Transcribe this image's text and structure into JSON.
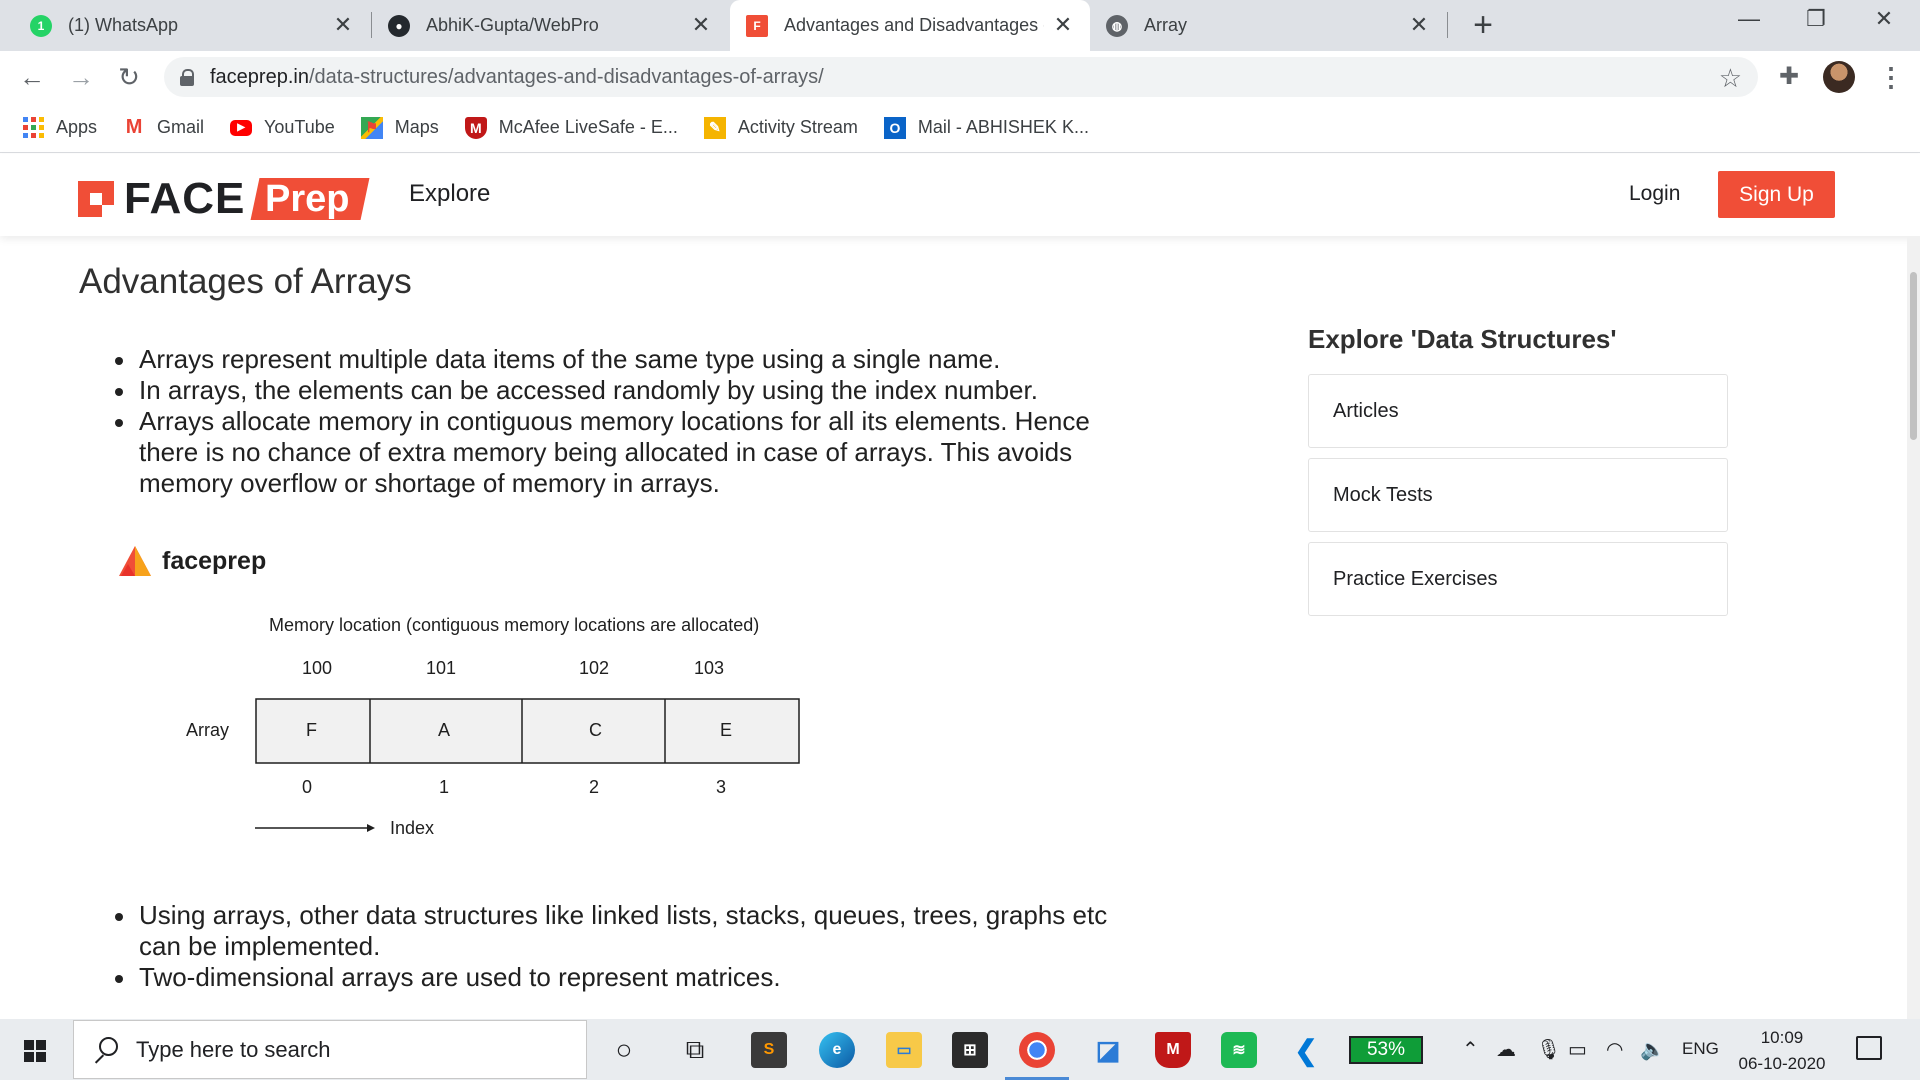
{
  "browser": {
    "tabs": [
      {
        "title": "(1) WhatsApp",
        "icon": "whatsapp-icon",
        "active": false
      },
      {
        "title": "AbhiK-Gupta/WebPro",
        "icon": "github-icon",
        "active": false
      },
      {
        "title": "Advantages and Disadvantages o",
        "icon": "faceprep-icon",
        "active": true
      },
      {
        "title": "Array",
        "icon": "globe-icon",
        "active": false
      }
    ],
    "new_tab_label": "+",
    "url": {
      "domain": "faceprep.in",
      "path": "/data-structures/advantages-and-disadvantages-of-arrays/"
    },
    "bookmarks": [
      {
        "label": "Apps",
        "icon": "apps-grid-icon"
      },
      {
        "label": "Gmail",
        "icon": "gmail-icon"
      },
      {
        "label": "YouTube",
        "icon": "youtube-icon"
      },
      {
        "label": "Maps",
        "icon": "maps-icon"
      },
      {
        "label": "McAfee LiveSafe - E...",
        "icon": "mcafee-icon"
      },
      {
        "label": "Activity Stream",
        "icon": "activity-stream-icon"
      },
      {
        "label": "Mail - ABHISHEK K...",
        "icon": "outlook-icon"
      }
    ]
  },
  "site": {
    "logo": {
      "face": "FACE",
      "prep": "Prep"
    },
    "nav": {
      "explore": "Explore",
      "login": "Login",
      "signup": "Sign Up"
    },
    "brand_color": "#f04e37"
  },
  "article": {
    "title": "Advantages of Arrays",
    "bullets_top": [
      "Arrays represent multiple data items of the same type using a single name.",
      "In arrays, the elements can be accessed randomly by using the index number.",
      "Arrays allocate memory in contiguous memory locations for all its elements. Hence there is no chance of extra memory being allocated in case of arrays. This avoids memory overflow or shortage of memory in arrays."
    ],
    "bullets_bottom": [
      "Using arrays, other data structures like linked lists, stacks, queues, trees, graphs etc can be implemented.",
      "Two-dimensional arrays are used to represent matrices."
    ],
    "diagram": {
      "brand": "faceprep",
      "caption": "Memory location (contiguous memory locations are allocated)",
      "row_label": "Array",
      "addresses": [
        "100",
        "101",
        "102",
        "103"
      ],
      "cells": [
        "F",
        "A",
        "C",
        "E"
      ],
      "indices": [
        "0",
        "1",
        "2",
        "3"
      ],
      "index_label": "Index"
    }
  },
  "sidebar": {
    "title": "Explore 'Data Structures'",
    "items": [
      "Articles",
      "Mock Tests",
      "Practice Exercises"
    ]
  },
  "taskbar": {
    "search_placeholder": "Type here to search",
    "battery": "53%",
    "language": "ENG",
    "time": "10:09",
    "date": "06-10-2020"
  }
}
